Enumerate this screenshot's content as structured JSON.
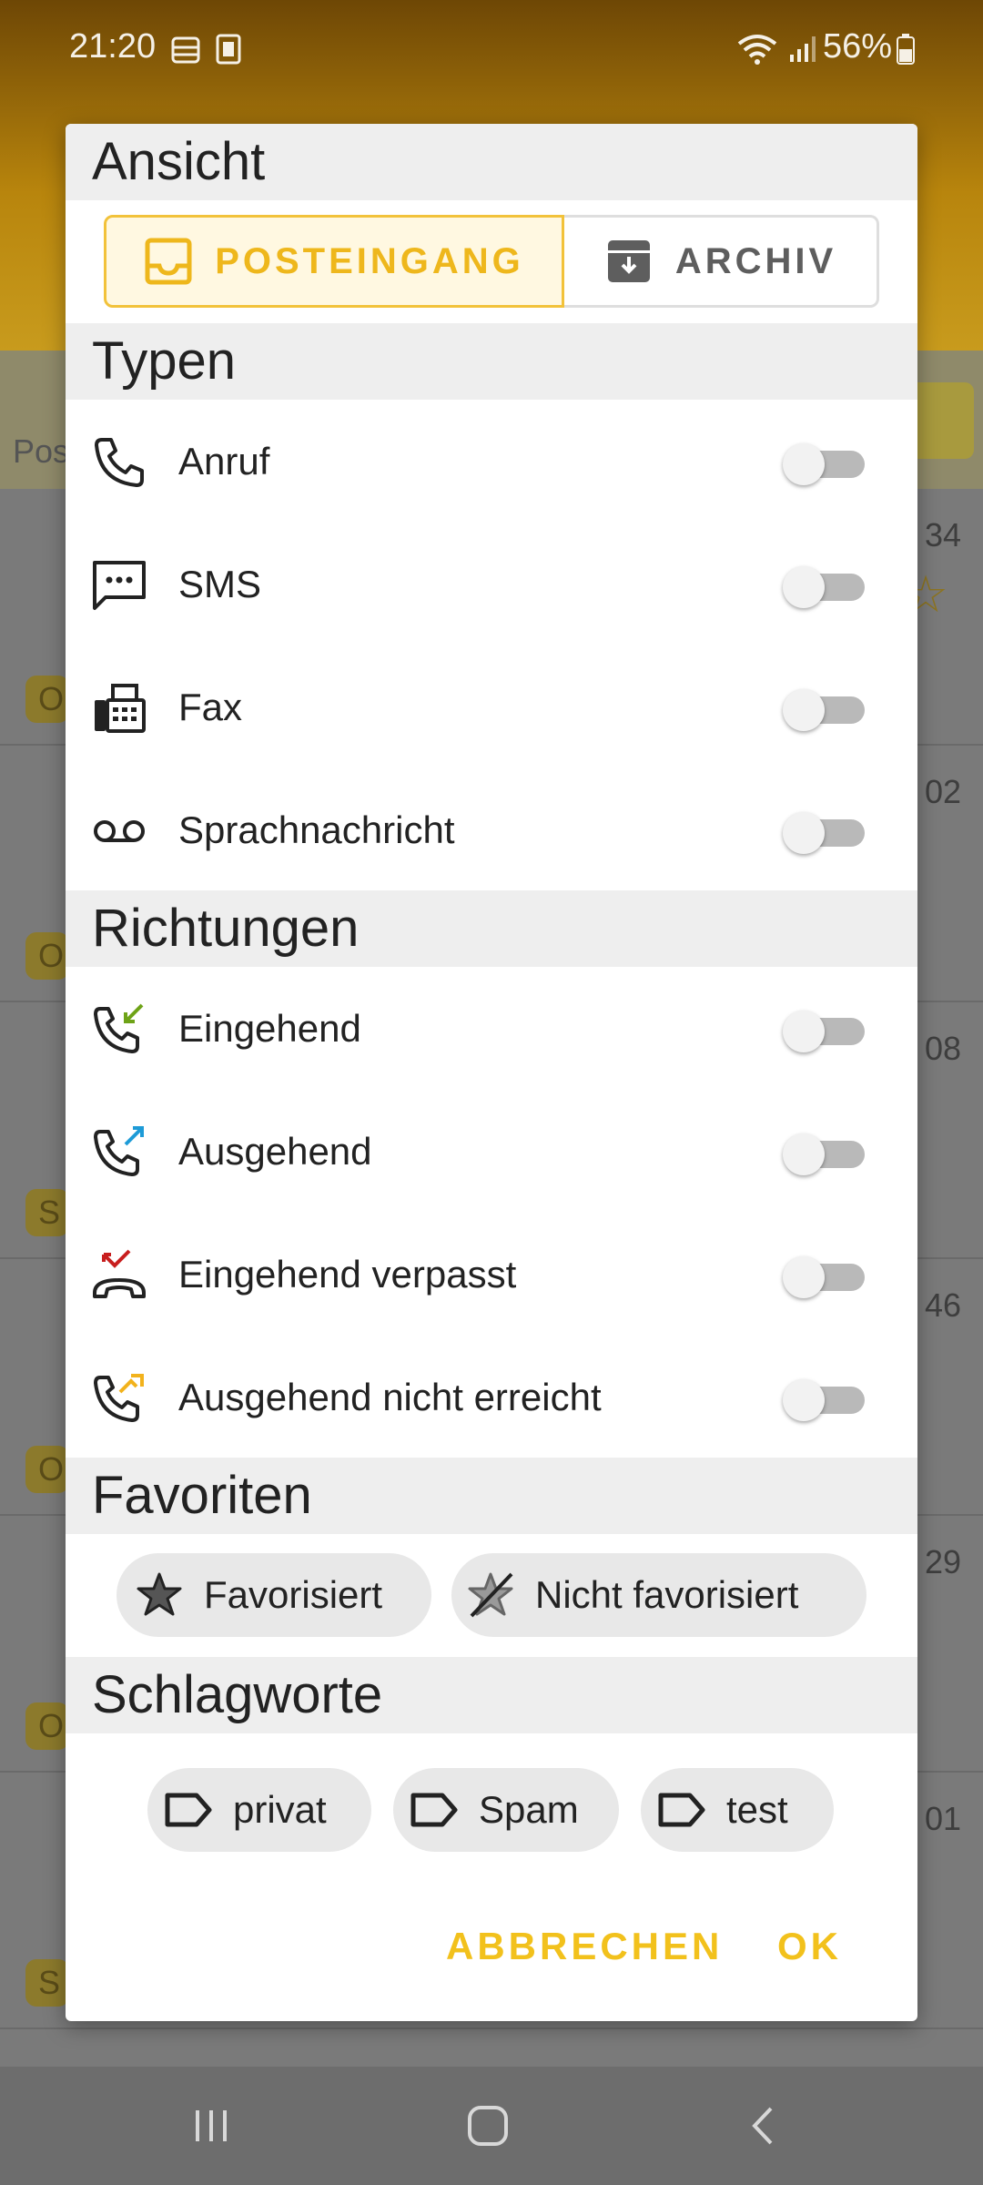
{
  "status_bar": {
    "time": "21:20",
    "battery": "56%"
  },
  "background": {
    "left_text": "Pos",
    "times": [
      "34",
      "02",
      "08",
      "46",
      "29",
      "01"
    ],
    "badges": [
      "O",
      "O",
      "S",
      "O",
      "O",
      "S"
    ]
  },
  "dialog": {
    "sections": {
      "view": "Ansicht",
      "types": "Typen",
      "directions": "Richtungen",
      "favorites": "Favoriten",
      "tags": "Schlagworte"
    },
    "view_toggle": {
      "inbox": "POSTEINGANG",
      "archive": "ARCHIV",
      "selected": "inbox"
    },
    "types": [
      {
        "label": "Anruf",
        "icon": "phone-icon",
        "enabled": false
      },
      {
        "label": "SMS",
        "icon": "sms-icon",
        "enabled": false
      },
      {
        "label": "Fax",
        "icon": "fax-icon",
        "enabled": false
      },
      {
        "label": "Sprachnachricht",
        "icon": "voicemail-icon",
        "enabled": false
      }
    ],
    "directions": [
      {
        "label": "Eingehend",
        "icon": "incoming-call-icon",
        "enabled": false
      },
      {
        "label": "Ausgehend",
        "icon": "outgoing-call-icon",
        "enabled": false
      },
      {
        "label": "Eingehend verpasst",
        "icon": "missed-call-icon",
        "enabled": false
      },
      {
        "label": "Ausgehend nicht erreicht",
        "icon": "outgoing-failed-icon",
        "enabled": false
      }
    ],
    "favorites": [
      {
        "label": "Favorisiert",
        "icon": "star-icon"
      },
      {
        "label": "Nicht favorisiert",
        "icon": "star-off-icon"
      }
    ],
    "tags": [
      {
        "label": "privat",
        "icon": "tag-icon"
      },
      {
        "label": "Spam",
        "icon": "tag-icon"
      },
      {
        "label": "test",
        "icon": "tag-icon"
      }
    ],
    "buttons": {
      "cancel": "ABBRECHEN",
      "ok": "OK"
    }
  },
  "colors": {
    "accent": "#f2c11c",
    "incoming": "#6ea317",
    "outgoing": "#1e9bd7",
    "missed": "#c81e1e",
    "failed": "#f2b21c"
  }
}
